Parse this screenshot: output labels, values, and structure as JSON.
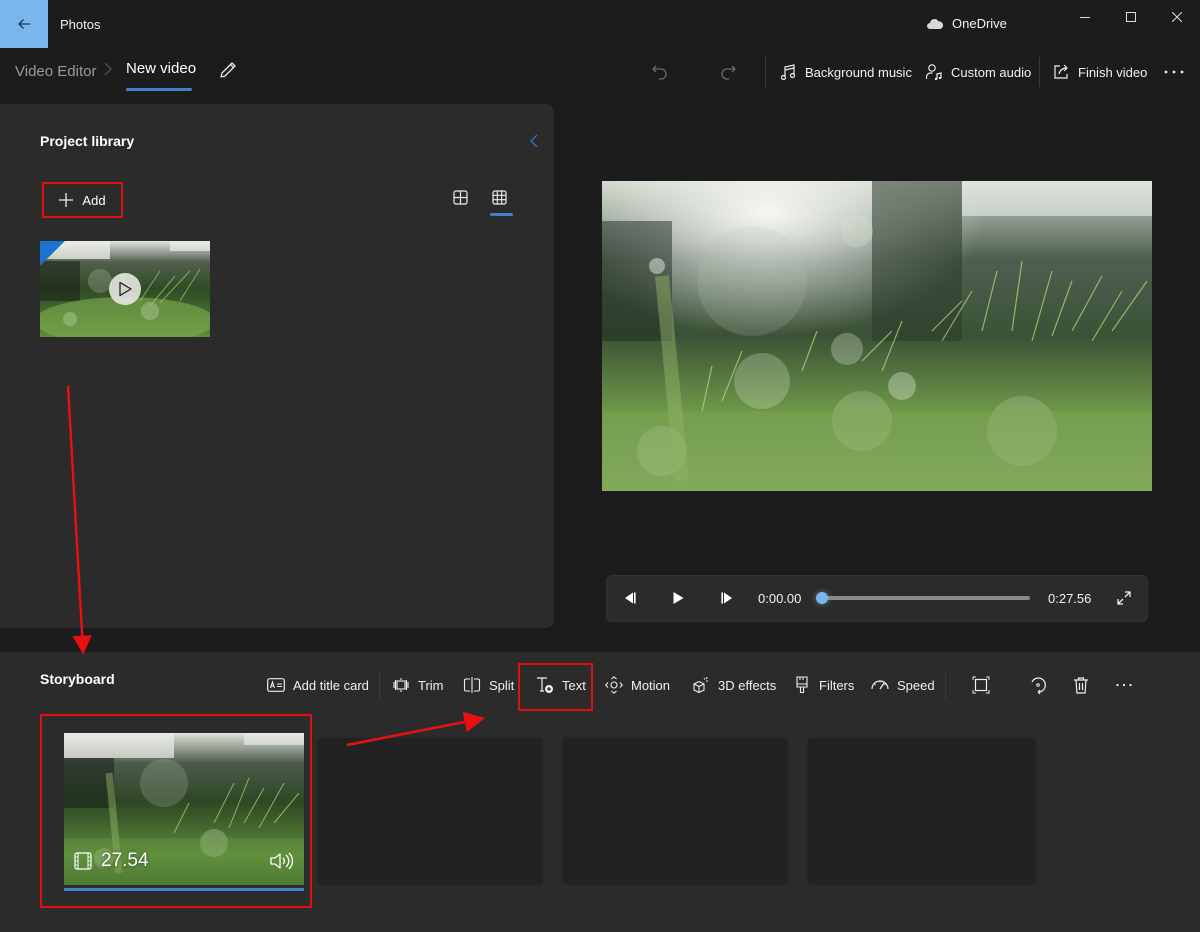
{
  "titlebar": {
    "app_title": "Photos",
    "back_icon": "arrow-left-icon",
    "onedrive_label": "OneDrive",
    "controls": [
      "minimize",
      "maximize",
      "close"
    ]
  },
  "breadcrumb": {
    "root": "Video Editor",
    "separator": ">",
    "current": "New video"
  },
  "commandbar": {
    "undo_icon": "undo-icon",
    "redo_icon": "redo-icon",
    "background_music": "Background music",
    "custom_audio": "Custom audio",
    "finish_video": "Finish video",
    "more": "..."
  },
  "library": {
    "title": "Project library",
    "add_label": "Add",
    "view_modes": [
      "large-grid",
      "small-grid"
    ],
    "active_view": "small-grid",
    "items": [
      {
        "type": "video",
        "in_use": true
      }
    ]
  },
  "player": {
    "current_time": "0:00.00",
    "total_time": "0:27.56",
    "progress": 0.0
  },
  "storyboard": {
    "title": "Storyboard",
    "tools": [
      {
        "label": "Add title card",
        "icon": "title-card-icon"
      },
      {
        "label": "Trim",
        "icon": "trim-icon"
      },
      {
        "label": "Split",
        "icon": "split-icon"
      },
      {
        "label": "Text",
        "icon": "text-add-icon"
      },
      {
        "label": "Motion",
        "icon": "motion-icon"
      },
      {
        "label": "3D effects",
        "icon": "3d-effects-icon"
      },
      {
        "label": "Filters",
        "icon": "filters-icon"
      },
      {
        "label": "Speed",
        "icon": "speed-icon"
      }
    ],
    "icon_tools": [
      "resize-icon",
      "rotate-icon",
      "delete-icon",
      "more-icon"
    ],
    "clips": [
      {
        "duration": "27.54",
        "selected": true,
        "audio": "volume-icon"
      }
    ],
    "empty_slots": 3
  },
  "annotations": {
    "color": "#e01010",
    "highlighted": [
      "add-button",
      "text-tool",
      "storyboard-clip"
    ]
  },
  "colors": {
    "accent": "#3b82c9",
    "accent_light": "#7ab6ec",
    "panel": "#2b2b2b",
    "background": "#1c1c1c"
  }
}
